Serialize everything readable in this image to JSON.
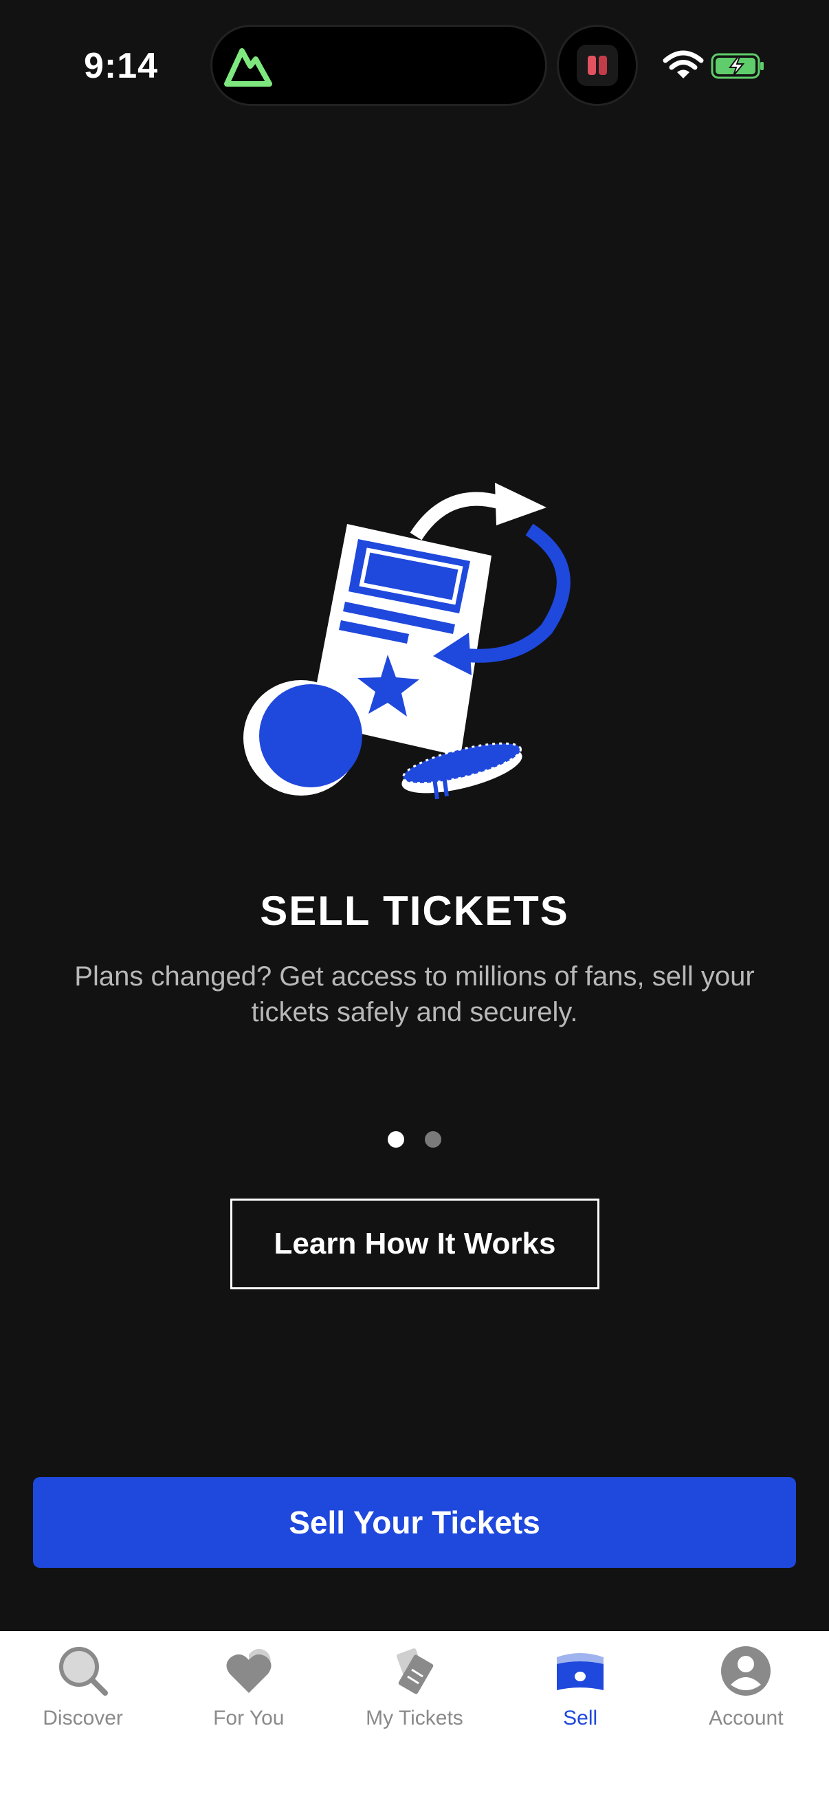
{
  "status_bar": {
    "time": "9:14",
    "icons": [
      "alltrails-activity-icon",
      "app-activity-icon",
      "wifi-icon",
      "battery-charging-icon"
    ]
  },
  "main": {
    "title": "SELL TICKETS",
    "subtitle": "Plans changed? Get access to millions of fans, sell your tickets safely and securely.",
    "pager": {
      "total": 2,
      "active_index": 0
    },
    "learn_button_label": "Learn How It Works",
    "sell_button_label": "Sell Your Tickets"
  },
  "tabbar": {
    "items": [
      {
        "label": "Discover",
        "icon": "search-icon",
        "active": false
      },
      {
        "label": "For You",
        "icon": "heart-icon",
        "active": false
      },
      {
        "label": "My Tickets",
        "icon": "ticket-icon",
        "active": false
      },
      {
        "label": "Sell",
        "icon": "money-icon",
        "active": true
      },
      {
        "label": "Account",
        "icon": "account-icon",
        "active": false
      }
    ]
  },
  "colors": {
    "background": "#121212",
    "accent": "#1f48dc",
    "text_primary": "#ffffff",
    "text_secondary": "#b8b8b8",
    "tab_inactive": "#8a8a8a"
  }
}
